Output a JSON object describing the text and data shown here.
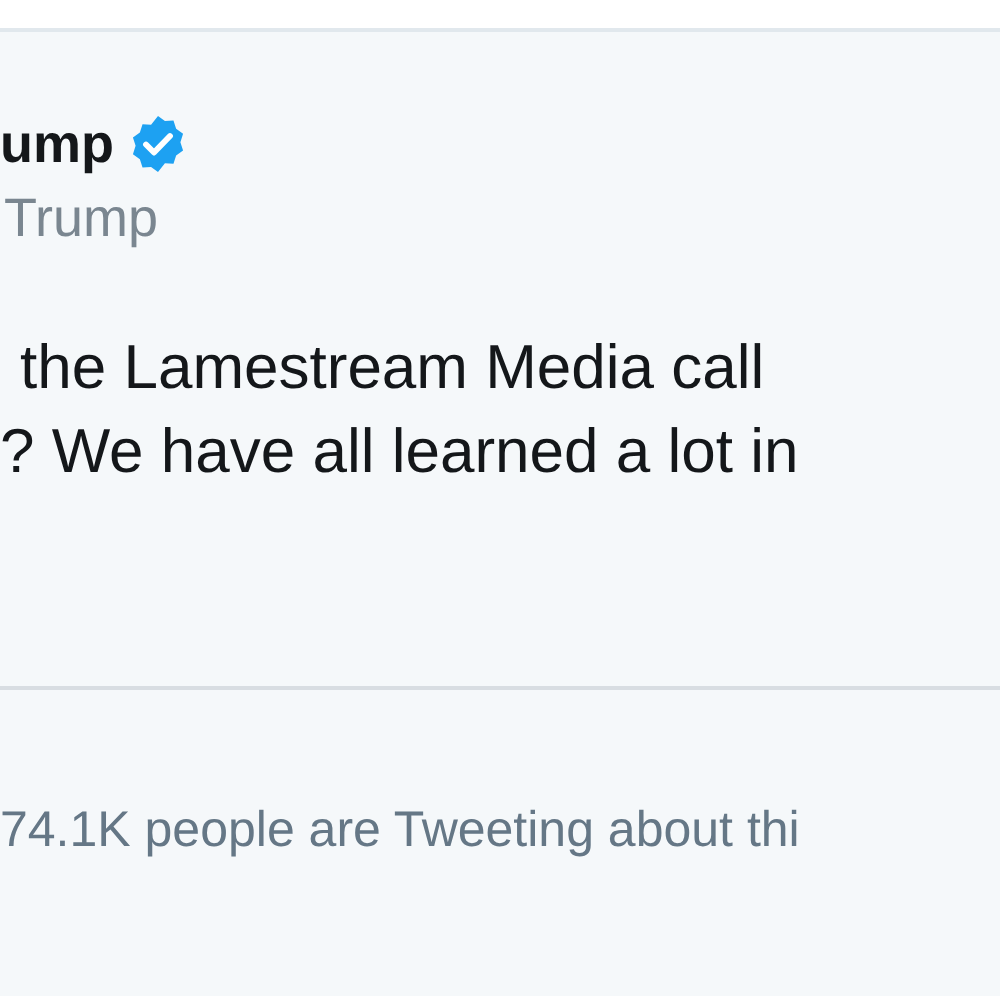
{
  "author": {
    "name": "ump",
    "verified": true,
    "handle": "Trump"
  },
  "tweet": {
    "lines": [
      "the Lamestream Media call",
      "? We have all learned a lot in"
    ]
  },
  "trending": "74.1K people are Tweeting about thi"
}
